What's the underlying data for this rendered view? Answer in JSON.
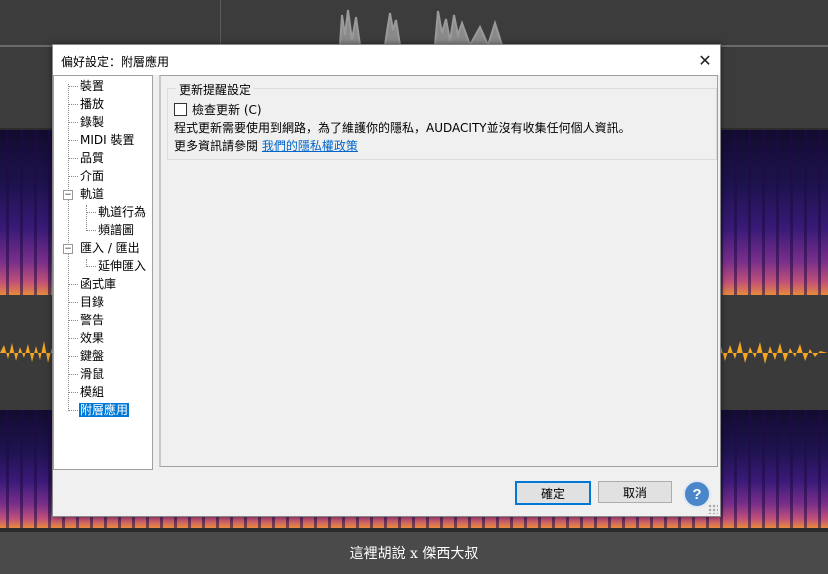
{
  "dialog": {
    "title": "偏好設定：附層應用",
    "close_icon": "close-icon"
  },
  "tree": {
    "items": [
      {
        "label": "裝置"
      },
      {
        "label": "播放"
      },
      {
        "label": "錄製"
      },
      {
        "label": "MIDI 裝置"
      },
      {
        "label": "品質"
      },
      {
        "label": "介面"
      },
      {
        "label": "軌道"
      },
      {
        "label": "軌道行為"
      },
      {
        "label": "頻譜圖"
      },
      {
        "label": "匯入 / 匯出"
      },
      {
        "label": "延伸匯入"
      },
      {
        "label": "函式庫"
      },
      {
        "label": "目錄"
      },
      {
        "label": "警告"
      },
      {
        "label": "效果"
      },
      {
        "label": "鍵盤"
      },
      {
        "label": "滑鼠"
      },
      {
        "label": "模組"
      },
      {
        "label": "附層應用",
        "selected": true
      }
    ]
  },
  "update_group": {
    "title": "更新提醒設定",
    "checkbox_label": "檢查更新 (C)",
    "checked": false,
    "privacy_text": "程式更新需要使用到網路，為了維護你的隱私，AUDACITY並沒有收集任何個人資訊。",
    "more_info_text": "更多資訊請參閱",
    "privacy_link": "我們的隱私權政策"
  },
  "buttons": {
    "ok": "確定",
    "cancel": "取消",
    "help": "?"
  },
  "background": {
    "caption": "這裡胡說 x 傑西大叔",
    "wave_color": "#f5a623"
  }
}
